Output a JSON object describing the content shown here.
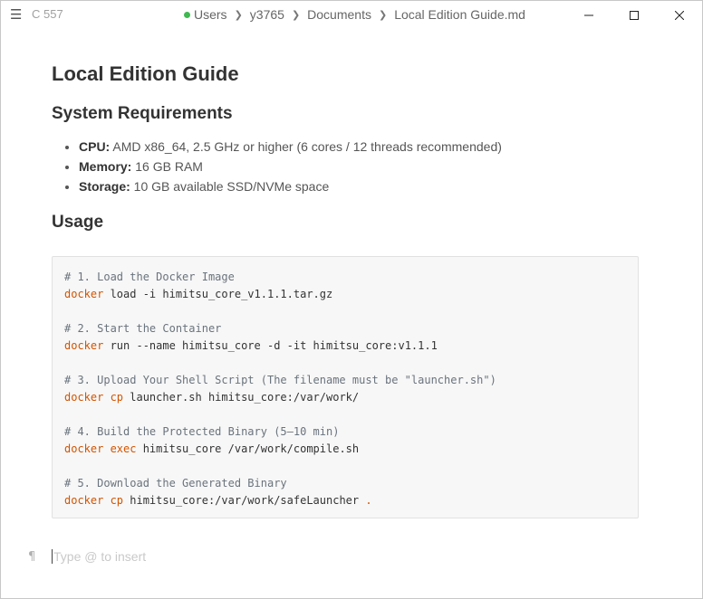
{
  "titlebar": {
    "doc_id": "C 557",
    "breadcrumb": [
      "Users",
      "y3765",
      "Documents",
      "Local Edition Guide.md"
    ],
    "status_color": "#3fb950"
  },
  "doc": {
    "title": "Local Edition Guide",
    "requirements_heading": "System Requirements",
    "requirements": [
      {
        "label": "CPU:",
        "value": " AMD x86_64, 2.5 GHz or higher (6 cores / 12 threads recommended)"
      },
      {
        "label": "Memory:",
        "value": " 16 GB RAM"
      },
      {
        "label": "Storage:",
        "value": " 10 GB available SSD/NVMe space"
      }
    ],
    "usage_heading": "Usage",
    "code_lines": [
      {
        "comment": "# 1. Load the Docker Image"
      },
      {
        "kw": "docker",
        "rest": " load -i himitsu_core_v1.1.1.tar.gz"
      },
      {
        "blank": ""
      },
      {
        "comment": "# 2. Start the Container"
      },
      {
        "kw": "docker",
        "rest": " run --name himitsu_core -d -it himitsu_core:v1.1.1"
      },
      {
        "blank": ""
      },
      {
        "comment": "# 3. Upload Your Shell Script (The filename must be \"launcher.sh\")"
      },
      {
        "kw": "docker cp",
        "rest": " launcher.sh himitsu_core:/var/work/"
      },
      {
        "blank": ""
      },
      {
        "comment": "# 4. Build the Protected Binary (5–10 min)"
      },
      {
        "kw": "docker exec",
        "rest": " himitsu_core /var/work/compile.sh"
      },
      {
        "blank": ""
      },
      {
        "comment": "# 5. Download the Generated Binary"
      },
      {
        "kw": "docker cp",
        "rest": " himitsu_core:/var/work/safeLauncher",
        "tail": " ."
      }
    ]
  },
  "editor": {
    "placeholder": "Type @ to insert"
  }
}
